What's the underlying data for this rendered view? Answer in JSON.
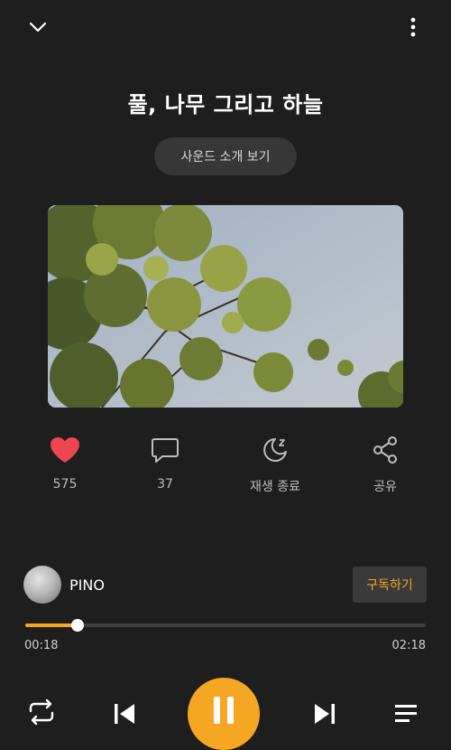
{
  "track": {
    "title": "풀, 나무 그리고 하늘",
    "intro_button": "사운드 소개 보기"
  },
  "actions": {
    "like_count": "575",
    "comment_count": "37",
    "sleep_timer_label": "재생 종료",
    "share_label": "공유"
  },
  "artist": {
    "name": "PINO",
    "subscribe_label": "구독하기"
  },
  "progress": {
    "current": "00:18",
    "total": "02:18",
    "fraction": 0.13
  },
  "colors": {
    "accent": "#f5a623",
    "like": "#f04452",
    "background": "#1e1e1e"
  },
  "icons": [
    "chevron-down-icon",
    "more-vertical-icon",
    "heart-icon",
    "comment-icon",
    "sleep-moon-icon",
    "share-icon",
    "repeat-icon",
    "previous-icon",
    "pause-icon",
    "next-icon",
    "playlist-icon"
  ]
}
